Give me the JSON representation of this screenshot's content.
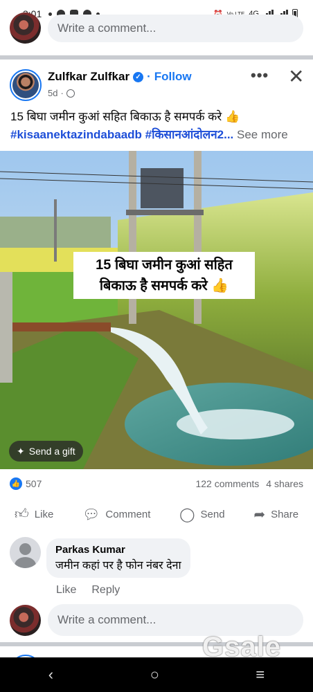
{
  "status_bar": {
    "time": "3:01",
    "network_label": "4G",
    "notification_icons": [
      "bell-dot-icon",
      "messenger-icon",
      "chat-icon",
      "messenger-icon"
    ],
    "right_icons": [
      "alarm-icon",
      "volte-icon",
      "signal-icon",
      "signal-icon",
      "battery-icon"
    ]
  },
  "top_comment_box": {
    "placeholder": "Write a comment..."
  },
  "post": {
    "author": "Zulfkar Zulfkar",
    "follow_label": "Follow",
    "time_ago": "5d",
    "separator": "·",
    "text_line": "15 बिघा जमीन कुआं सहित बिकाऊ है समपर्क करे 👍",
    "hashtags": "#kisaanektazindabaadb #किसानआंदोलन2...",
    "see_more": "See more",
    "image_overlay_line1": "15 बिघा जमीन कुआं सहित",
    "image_overlay_line2": "बिकाऊ है समपर्क करे 👍",
    "send_gift_label": "Send a gift",
    "reactions_count": "507",
    "comments_count": "122 comments",
    "shares_count": "4 shares",
    "actions": {
      "like": "Like",
      "comment": "Comment",
      "send": "Send",
      "share": "Share"
    }
  },
  "comment": {
    "author": "Parkas Kumar",
    "text": "जमीन कहां पर है फोन नंबर देना",
    "like_label": "Like",
    "reply_label": "Reply"
  },
  "bottom_comment_box": {
    "placeholder": "Write a comment..."
  },
  "watermark": "Gsale",
  "colors": {
    "accent": "#1877f2",
    "secondary_text": "#65676b",
    "input_bg": "#f0f2f5"
  }
}
